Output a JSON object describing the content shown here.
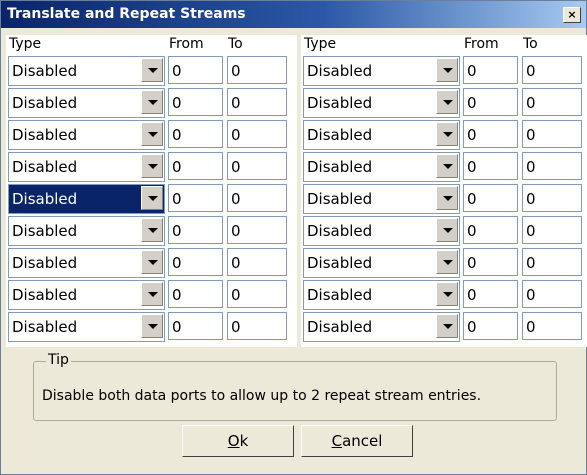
{
  "window": {
    "title": "Translate and Repeat Streams",
    "close_label": "×"
  },
  "columns": {
    "type": "Type",
    "from": "From",
    "to": "To"
  },
  "left_rows": [
    {
      "type": "Disabled",
      "from": "0",
      "to": "0"
    },
    {
      "type": "Disabled",
      "from": "0",
      "to": "0"
    },
    {
      "type": "Disabled",
      "from": "0",
      "to": "0"
    },
    {
      "type": "Disabled",
      "from": "0",
      "to": "0"
    },
    {
      "type": "Disabled",
      "from": "0",
      "to": "0"
    },
    {
      "type": "Disabled",
      "from": "0",
      "to": "0"
    },
    {
      "type": "Disabled",
      "from": "0",
      "to": "0"
    },
    {
      "type": "Disabled",
      "from": "0",
      "to": "0"
    },
    {
      "type": "Disabled",
      "from": "0",
      "to": "0"
    }
  ],
  "right_rows": [
    {
      "type": "Disabled",
      "from": "0",
      "to": "0"
    },
    {
      "type": "Disabled",
      "from": "0",
      "to": "0"
    },
    {
      "type": "Disabled",
      "from": "0",
      "to": "0"
    },
    {
      "type": "Disabled",
      "from": "0",
      "to": "0"
    },
    {
      "type": "Disabled",
      "from": "0",
      "to": "0"
    },
    {
      "type": "Disabled",
      "from": "0",
      "to": "0"
    },
    {
      "type": "Disabled",
      "from": "0",
      "to": "0"
    },
    {
      "type": "Disabled",
      "from": "0",
      "to": "0"
    },
    {
      "type": "Disabled",
      "from": "0",
      "to": "0"
    }
  ],
  "selected_left_row": 4,
  "tip": {
    "legend": "Tip",
    "message": "Disable both data ports to allow up to 2 repeat stream entries."
  },
  "buttons": {
    "ok": {
      "mnemonic": "O",
      "rest": "k"
    },
    "cancel": {
      "mnemonic": "C",
      "rest": "ancel"
    }
  }
}
